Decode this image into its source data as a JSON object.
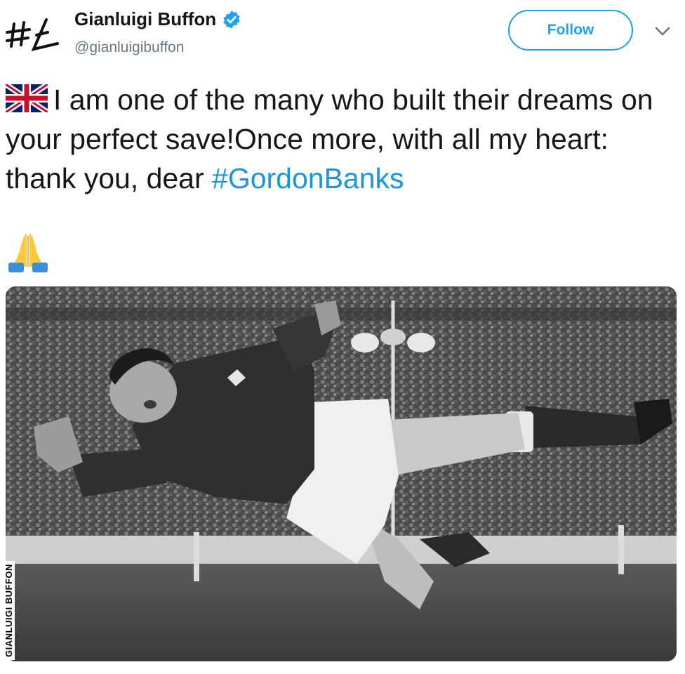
{
  "user": {
    "display_name": "Gianluigi Buffon",
    "handle": "@gianluigibuffon",
    "avatar_icon": "gl-signature-logo",
    "verified_icon": "verified-badge-icon"
  },
  "actions": {
    "follow_label": "Follow",
    "more_icon": "chevron-down-icon"
  },
  "tweet": {
    "flag_icon": "uk-flag-emoji",
    "text_main": "I am one of the many who built their dreams on your perfect save!Once more, with all my heart: thank you, dear ",
    "hashtag": "#GordonBanks",
    "emoji_icon": "folded-hands-emoji"
  },
  "media": {
    "description_icon": "goalkeeper-diving-photo",
    "credit": "GIANLUIGI BUFFON"
  },
  "colors": {
    "accent": "#1da1f2",
    "hashtag": "#1b95e0",
    "handle": "#657786"
  }
}
